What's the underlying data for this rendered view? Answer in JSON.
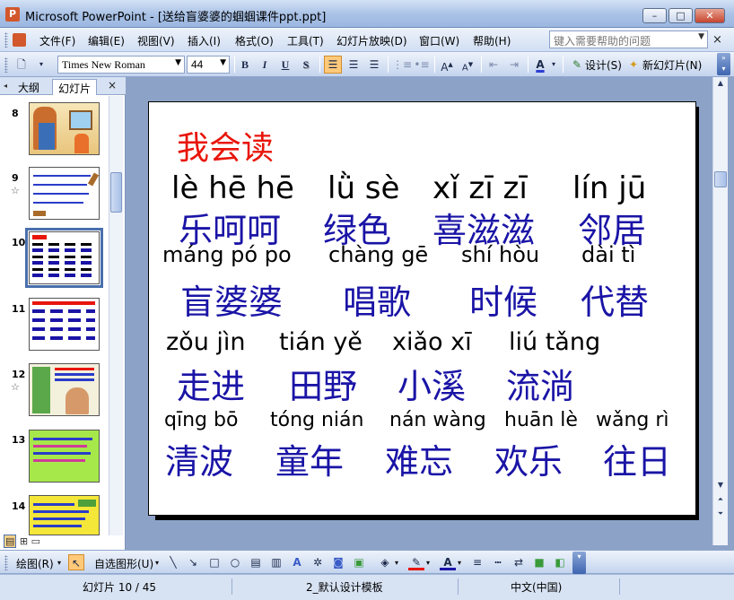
{
  "window": {
    "title": "Microsoft PowerPoint - [送给盲婆婆的蝈蝈课件ppt.ppt]",
    "buttons": {
      "minimize": "–",
      "maximize": "□",
      "close": "✕"
    }
  },
  "menubar": {
    "items": [
      "文件(F)",
      "编辑(E)",
      "视图(V)",
      "插入(I)",
      "格式(O)",
      "工具(T)",
      "幻灯片放映(D)",
      "窗口(W)",
      "帮助(H)"
    ],
    "help_placeholder": "键入需要帮助的问题",
    "close_label": "×"
  },
  "toolbar": {
    "font_name": "Times New Roman",
    "font_size": "44",
    "bold": "B",
    "italic": "I",
    "underline": "U",
    "shadow": "S",
    "design_label": "设计(S)",
    "new_slide_label": "新幻灯片(N)"
  },
  "leftpanel": {
    "tab_outline": "大纲",
    "tab_slides": "幻灯片",
    "tab_close": "×",
    "thumbnails": [
      {
        "number": "8",
        "star": ""
      },
      {
        "number": "9",
        "star": "☆"
      },
      {
        "number": "10",
        "star": ""
      },
      {
        "number": "11",
        "star": ""
      },
      {
        "number": "12",
        "star": "☆"
      },
      {
        "number": "13",
        "star": ""
      },
      {
        "number": "14",
        "star": ""
      }
    ],
    "selected_slide": 10
  },
  "slide": {
    "title": "我会读",
    "rows": [
      {
        "pinyin": [
          "lè hē hē",
          "lǜ sè",
          "xǐ zī zī",
          "lín jū"
        ],
        "hanzi": [
          "乐呵呵",
          "绿色",
          "喜滋滋",
          "邻居"
        ]
      },
      {
        "pinyin": [
          "máng pó po",
          "chàng gē",
          "shí hòu",
          "dài tì"
        ],
        "hanzi": [
          "盲婆婆",
          "唱歌",
          "时候",
          "代替"
        ]
      },
      {
        "pinyin": [
          "zǒu jìn",
          "tián yě",
          "xiǎo xī",
          "liú tǎng"
        ],
        "hanzi": [
          "走进",
          "田野",
          "小溪",
          "流淌"
        ]
      },
      {
        "pinyin": [
          "qīng bō",
          "tóng nián",
          "nán wàng",
          "huān lè",
          "wǎng rì"
        ],
        "hanzi": [
          "清波",
          "童年",
          "难忘",
          "欢乐",
          "往日"
        ]
      }
    ],
    "colors": {
      "title": "#e8150a",
      "hanzi": "#1a14a6",
      "pinyin": "#000000"
    }
  },
  "drawbar": {
    "draw_label": "绘图(R)",
    "autoshapes_label": "自选图形(U)"
  },
  "statusbar": {
    "slide_info": "幻灯片 10 / 45",
    "template": "2_默认设计模板",
    "language": "中文(中国)"
  }
}
